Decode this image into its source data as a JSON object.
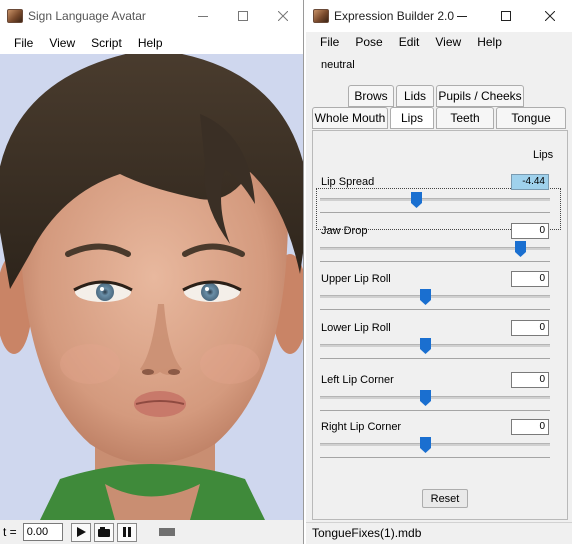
{
  "left_window": {
    "title": "Sign Language Avatar",
    "menu": [
      "File",
      "View",
      "Script",
      "Help"
    ],
    "time_label": "t =",
    "time_value": "0.00",
    "icons": [
      "app-icon",
      "minimize-icon",
      "maximize-icon",
      "close-icon",
      "play-icon",
      "record-icon",
      "pause-icon"
    ]
  },
  "right_window": {
    "title": "Expression Builder 2.0",
    "menu": [
      "File",
      "Pose",
      "Edit",
      "View",
      "Help"
    ],
    "pose_name": "neutral",
    "tabs_top": [
      "Brows",
      "Lids",
      "Pupils / Cheeks"
    ],
    "tabs_bottom": [
      "Whole Mouth",
      "Lips",
      "Teeth",
      "Tongue"
    ],
    "active_tab": "Lips",
    "panel_heading": "Lips",
    "params": [
      {
        "label": "Lip Spread",
        "value": "-4.44",
        "slider_fraction": 0.45,
        "focused": true
      },
      {
        "label": "Jaw Drop",
        "value": "0",
        "slider_fraction": 1.0,
        "focused": false
      },
      {
        "label": "Upper Lip Roll",
        "value": "0",
        "slider_fraction": 0.5,
        "focused": false
      },
      {
        "label": "Lower Lip Roll",
        "value": "0",
        "slider_fraction": 0.5,
        "focused": false
      },
      {
        "label": "Left Lip Corner",
        "value": "0",
        "slider_fraction": 0.5,
        "focused": false
      },
      {
        "label": "Right Lip Corner",
        "value": "0",
        "slider_fraction": 0.5,
        "focused": false
      }
    ],
    "reset_label": "Reset",
    "status": "TongueFixes(1).mdb"
  },
  "colors": {
    "slider_thumb": "#1a6fd0",
    "value_highlight": "#9fd1ec",
    "viewport_bg": "#cfd7ee",
    "hair": "#3b3025",
    "skin": "#d9a48a",
    "eyes": "#6a8fa8",
    "lips": "#c8796a",
    "shirt": "#3f8a3a"
  }
}
